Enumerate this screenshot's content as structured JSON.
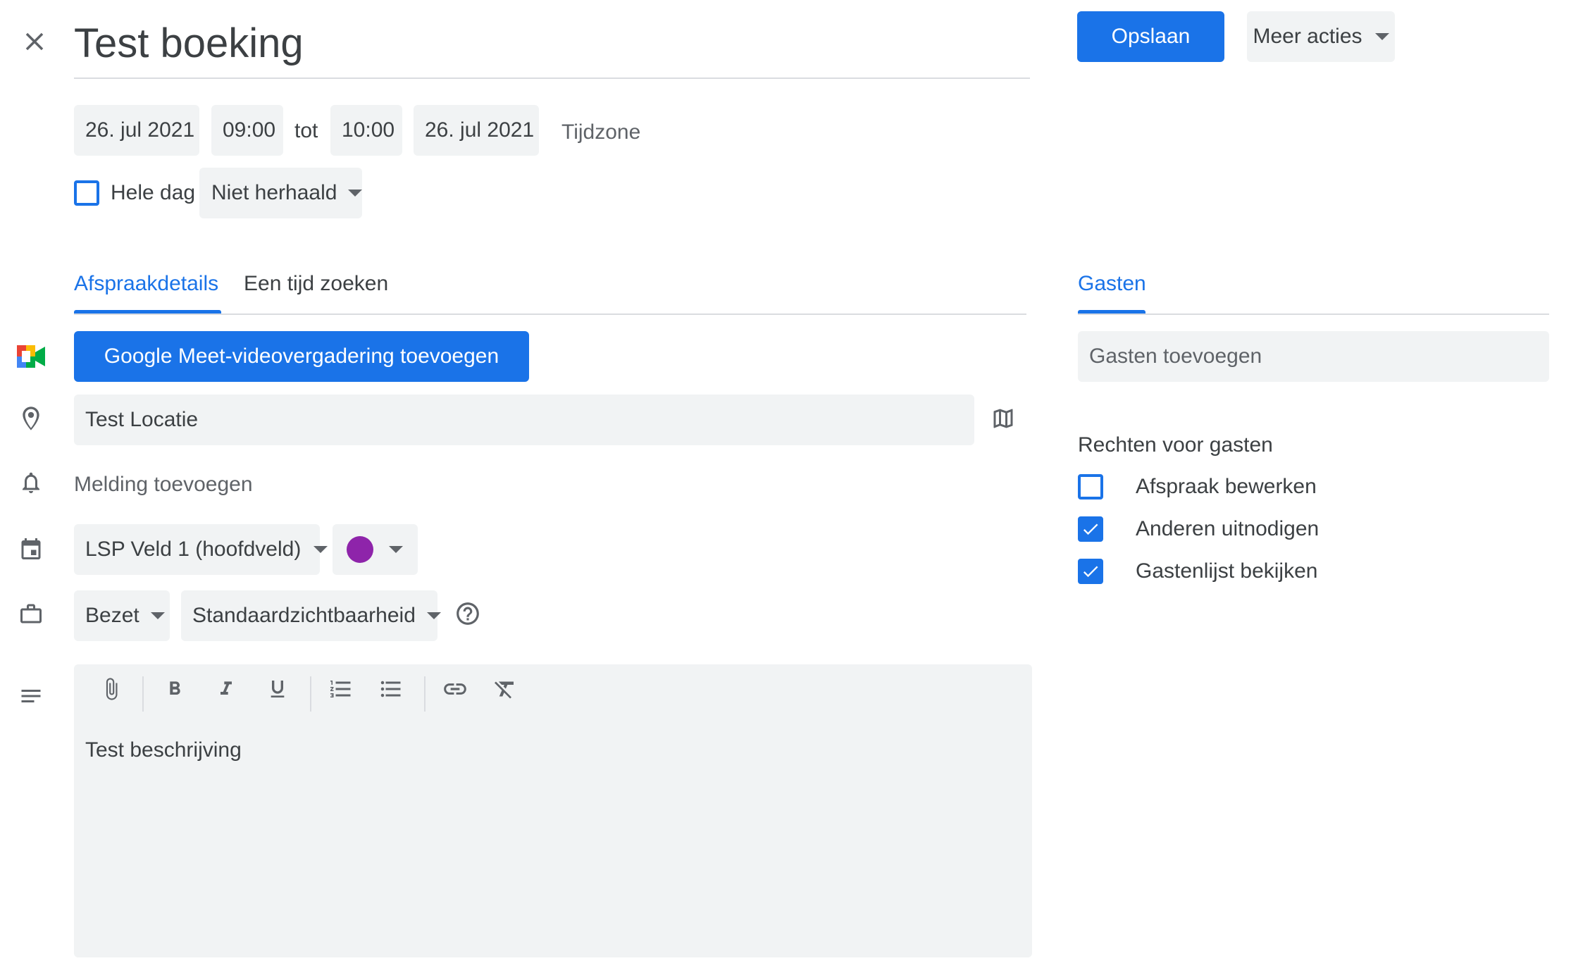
{
  "header": {
    "title": "Test boeking",
    "save_label": "Opslaan",
    "more_actions_label": "Meer acties"
  },
  "datetime": {
    "start_date": "26. jul 2021",
    "start_time": "09:00",
    "to_label": "tot",
    "end_time": "10:00",
    "end_date": "26. jul 2021",
    "timezone_label": "Tijdzone",
    "all_day_label": "Hele dag",
    "all_day_checked": false,
    "repeat_label": "Niet herhaald"
  },
  "tabs": {
    "details_label": "Afspraakdetails",
    "find_time_label": "Een tijd zoeken",
    "active": "details"
  },
  "meet": {
    "button_label": "Google Meet-videovergadering toevoegen"
  },
  "location": {
    "value": "Test Locatie"
  },
  "notification": {
    "label": "Melding toevoegen"
  },
  "calendar": {
    "name": "LSP Veld 1 (hoofdveld)",
    "color": "#8e24aa"
  },
  "availability": {
    "status": "Bezet",
    "visibility": "Standaardzichtbaarheid"
  },
  "description": {
    "text": "Test beschrijving"
  },
  "guests": {
    "tab_label": "Gasten",
    "input_placeholder": "Gasten toevoegen",
    "permissions_title": "Rechten voor gasten",
    "permissions": [
      {
        "label": "Afspraak bewerken",
        "checked": false
      },
      {
        "label": "Anderen uitnodigen",
        "checked": true
      },
      {
        "label": "Gastenlijst bekijken",
        "checked": true
      }
    ]
  },
  "colors": {
    "accent": "#1a73e8",
    "field_bg": "#f1f3f4",
    "text": "#3c4043",
    "icon": "#5f6368"
  }
}
